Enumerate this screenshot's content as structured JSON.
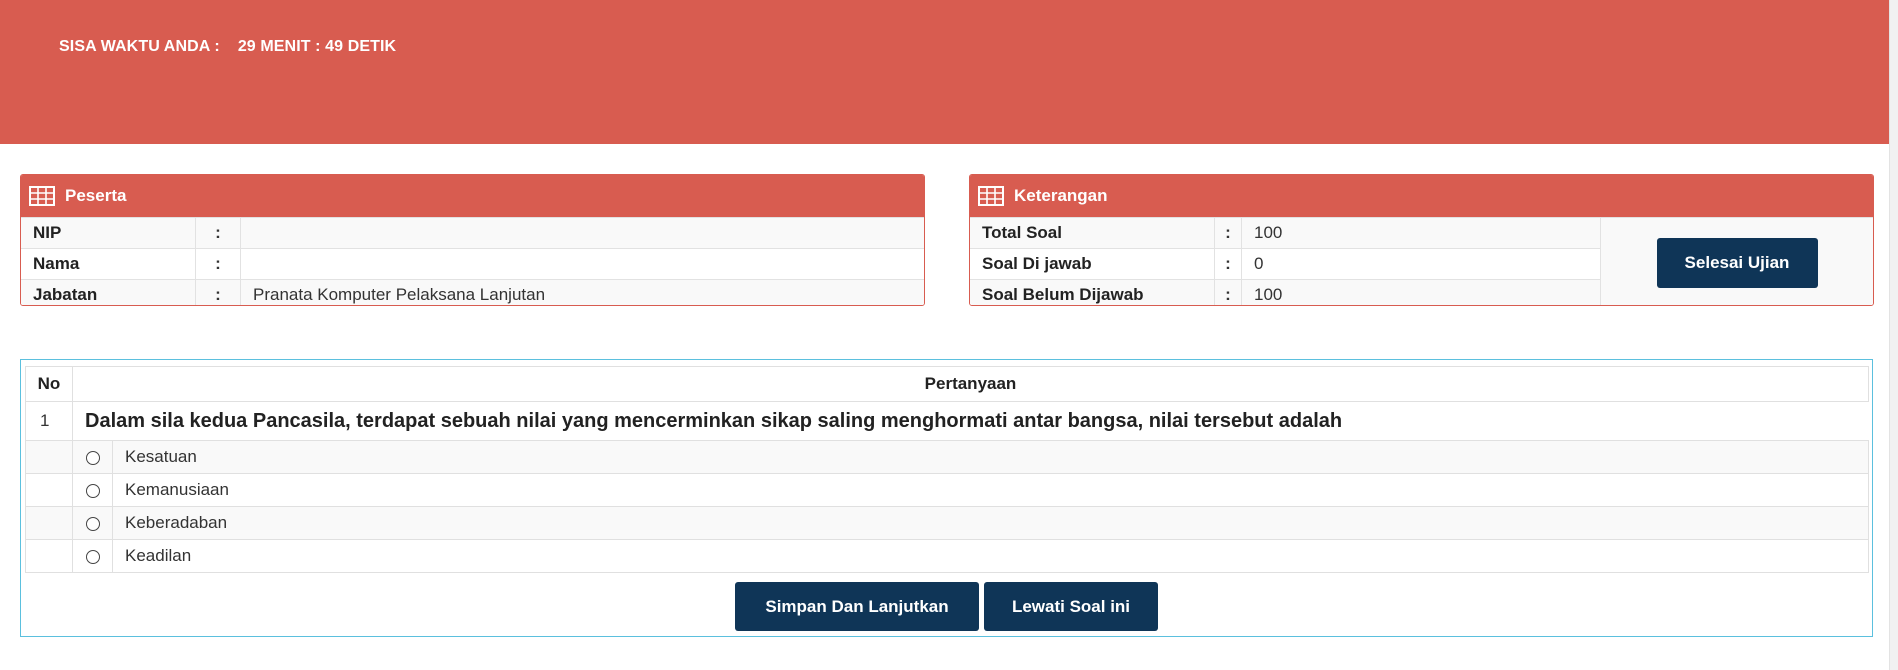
{
  "timer": {
    "label": "SISA WAKTU ANDA :",
    "value": "29 MENIT : 49 DETIK"
  },
  "colors": {
    "header_bg": "#d85c50",
    "button_bg": "#0f3557",
    "question_border": "#5bc0de"
  },
  "peserta": {
    "title": "Peserta",
    "icon": "table-grid-icon",
    "rows": [
      {
        "label": "NIP",
        "colon": ":",
        "value": ""
      },
      {
        "label": "Nama",
        "colon": ":",
        "value": ""
      },
      {
        "label": "Jabatan",
        "colon": ":",
        "value": "Pranata Komputer Pelaksana Lanjutan"
      }
    ]
  },
  "keterangan": {
    "title": "Keterangan",
    "icon": "table-grid-icon",
    "rows": [
      {
        "label": "Total Soal",
        "colon": ":",
        "value": "100"
      },
      {
        "label": "Soal Di jawab",
        "colon": ":",
        "value": "0"
      },
      {
        "label": "Soal Belum Dijawab",
        "colon": ":",
        "value": "100"
      }
    ],
    "finish_button": "Selesai Ujian"
  },
  "question": {
    "headers": {
      "no": "No",
      "question": "Pertanyaan"
    },
    "number": "1",
    "text": "Dalam sila kedua Pancasila, terdapat sebuah nilai yang mencerminkan sikap saling menghormati antar bangsa, nilai tersebut adalah",
    "options": [
      "Kesatuan",
      "Kemanusiaan",
      "Keberadaban",
      "Keadilan"
    ],
    "selected": null
  },
  "actions": {
    "save_next": "Simpan Dan Lanjutkan",
    "skip": "Lewati Soal ini"
  }
}
